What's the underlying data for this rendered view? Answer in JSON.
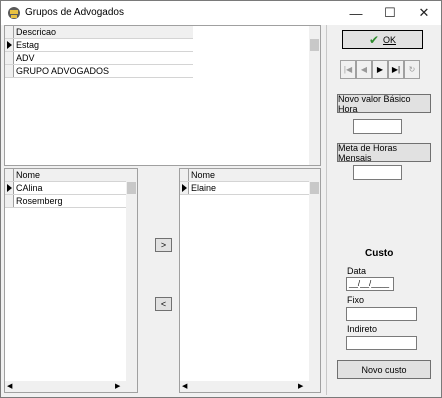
{
  "window": {
    "title": "Grupos de Advogados",
    "minimize": "—",
    "maximize": "☐",
    "close": "✕"
  },
  "groups": {
    "header": "Descricao",
    "rows": [
      "Estag",
      "ADV",
      "GRUPO  ADVOGADOS"
    ]
  },
  "left_list": {
    "header": "Nome",
    "rows": [
      "CAlina",
      "Rosemberg"
    ]
  },
  "right_list": {
    "header": "Nome",
    "rows": [
      "Elaine"
    ]
  },
  "move": {
    "right": ">",
    "left": "<"
  },
  "ok": {
    "label": "OK",
    "check": "✔"
  },
  "navigator": [
    "|◀",
    "◀",
    "▶",
    "▶|",
    "↻"
  ],
  "valor_btn": "Novo valor Básico Hora",
  "meta_btn": "Meta de Horas Mensais",
  "custo": {
    "heading": "Custo",
    "data_label": "Data",
    "data_value": "__/__/____",
    "fixo_label": "Fixo",
    "indireto_label": "Indireto",
    "novo_btn": "Novo custo"
  },
  "icons": {
    "app": "judge-icon",
    "ok": "check-icon"
  },
  "colors": {
    "ok_check": "#2e8b2e"
  }
}
